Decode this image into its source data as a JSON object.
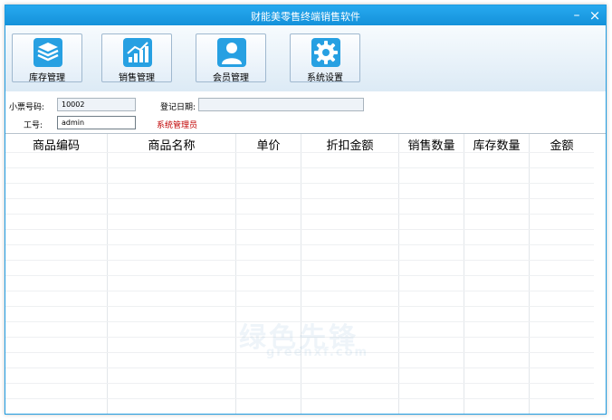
{
  "window": {
    "title": "财能美零售终端销售软件"
  },
  "window_controls": {
    "minimize": "–",
    "close": "×"
  },
  "toolbar": {
    "buttons": [
      {
        "label": "库存管理",
        "icon": "layers-icon"
      },
      {
        "label": "销售管理",
        "icon": "bar-chart-icon"
      },
      {
        "label": "会员管理",
        "icon": "user-icon"
      },
      {
        "label": "系统设置",
        "icon": "gear-icon"
      }
    ]
  },
  "form": {
    "receipt_label": "小票号码:",
    "receipt_value": "10002",
    "date_label": "登记日期:",
    "date_value": "",
    "staff_label": "工号:",
    "staff_value": "admin",
    "role_text": "系统管理员"
  },
  "table": {
    "columns": [
      "商品编码",
      "商品名称",
      "单价",
      "折扣金额",
      "销售数量",
      "库存数量",
      "金额"
    ],
    "rows": []
  },
  "watermark": {
    "main": "绿色先锋",
    "sub": "greenxf.com"
  },
  "colors": {
    "titlebar": "#1e9be0",
    "icon_bg": "#27a0e2",
    "role_text": "#c00000"
  }
}
